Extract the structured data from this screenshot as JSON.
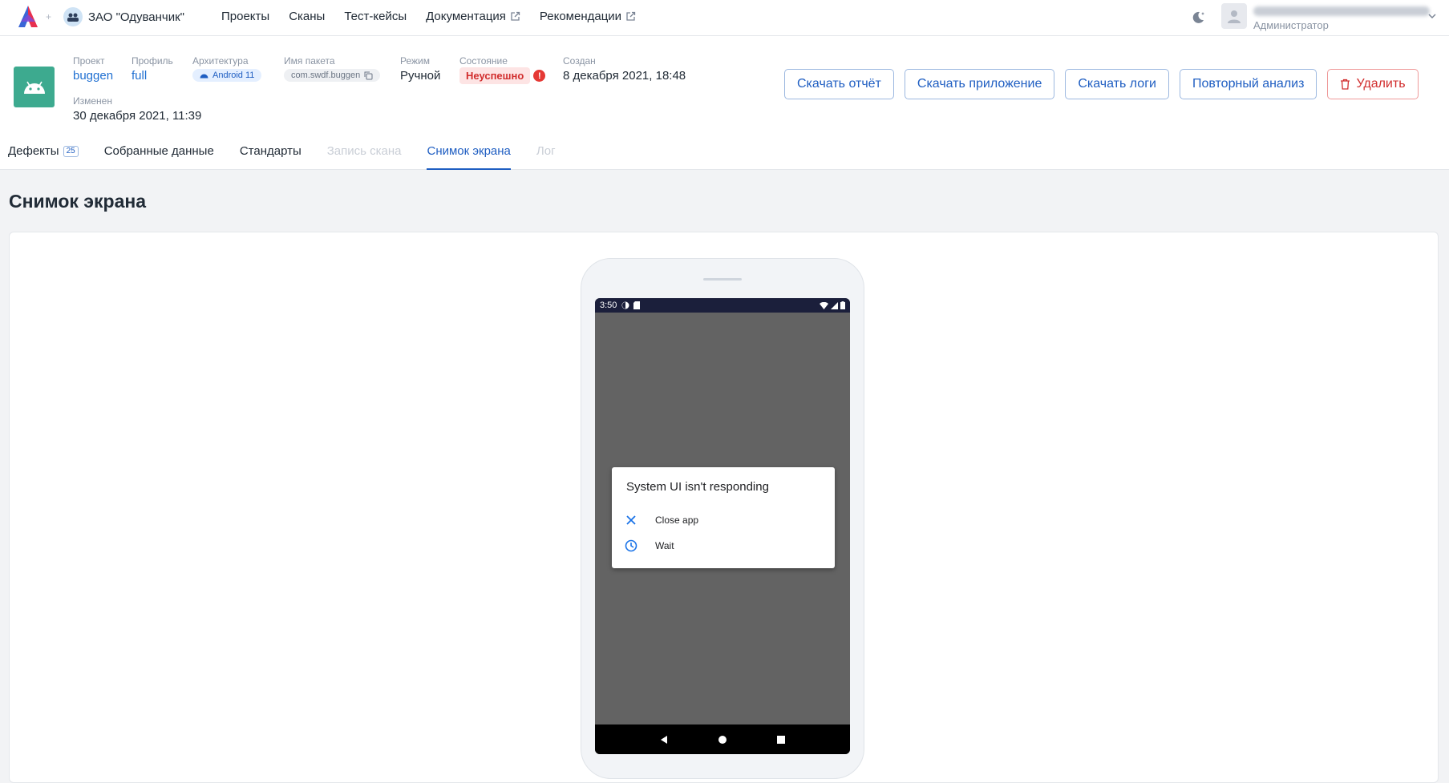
{
  "topbar": {
    "org_name": "ЗАО \"Одуванчик\"",
    "nav": [
      {
        "label": "Проекты",
        "external": false
      },
      {
        "label": "Сканы",
        "external": false
      },
      {
        "label": "Тест-кейсы",
        "external": false
      },
      {
        "label": "Документация",
        "external": true
      },
      {
        "label": "Рекомендации",
        "external": true
      }
    ],
    "user": {
      "role": "Администратор"
    }
  },
  "scan": {
    "project": {
      "label": "Проект",
      "value": "buggen"
    },
    "profile": {
      "label": "Профиль",
      "value": "full"
    },
    "arch": {
      "label": "Архитектура",
      "value": "Android 11"
    },
    "package": {
      "label": "Имя пакета",
      "value": "com.swdf.buggen"
    },
    "mode": {
      "label": "Режим",
      "value": "Ручной"
    },
    "state": {
      "label": "Состояние",
      "value": "Неуспешно"
    },
    "created": {
      "label": "Создан",
      "value": "8 декабря 2021, 18:48"
    },
    "modified": {
      "label": "Изменен",
      "value": "30 декабря 2021, 11:39"
    }
  },
  "actions": {
    "download_report": "Скачать отчёт",
    "download_app": "Скачать приложение",
    "download_logs": "Скачать логи",
    "reanalyze": "Повторный анализ",
    "delete": "Удалить"
  },
  "tabs": [
    {
      "label": "Дефекты",
      "count": "25"
    },
    {
      "label": "Собранные данные"
    },
    {
      "label": "Стандарты"
    },
    {
      "label": "Запись скана"
    },
    {
      "label": "Снимок экрана"
    },
    {
      "label": "Лог"
    }
  ],
  "page_title": "Снимок экрана",
  "device": {
    "time": "3:50",
    "dialog": {
      "title": "System UI isn't responding",
      "close": "Close app",
      "wait": "Wait"
    }
  }
}
